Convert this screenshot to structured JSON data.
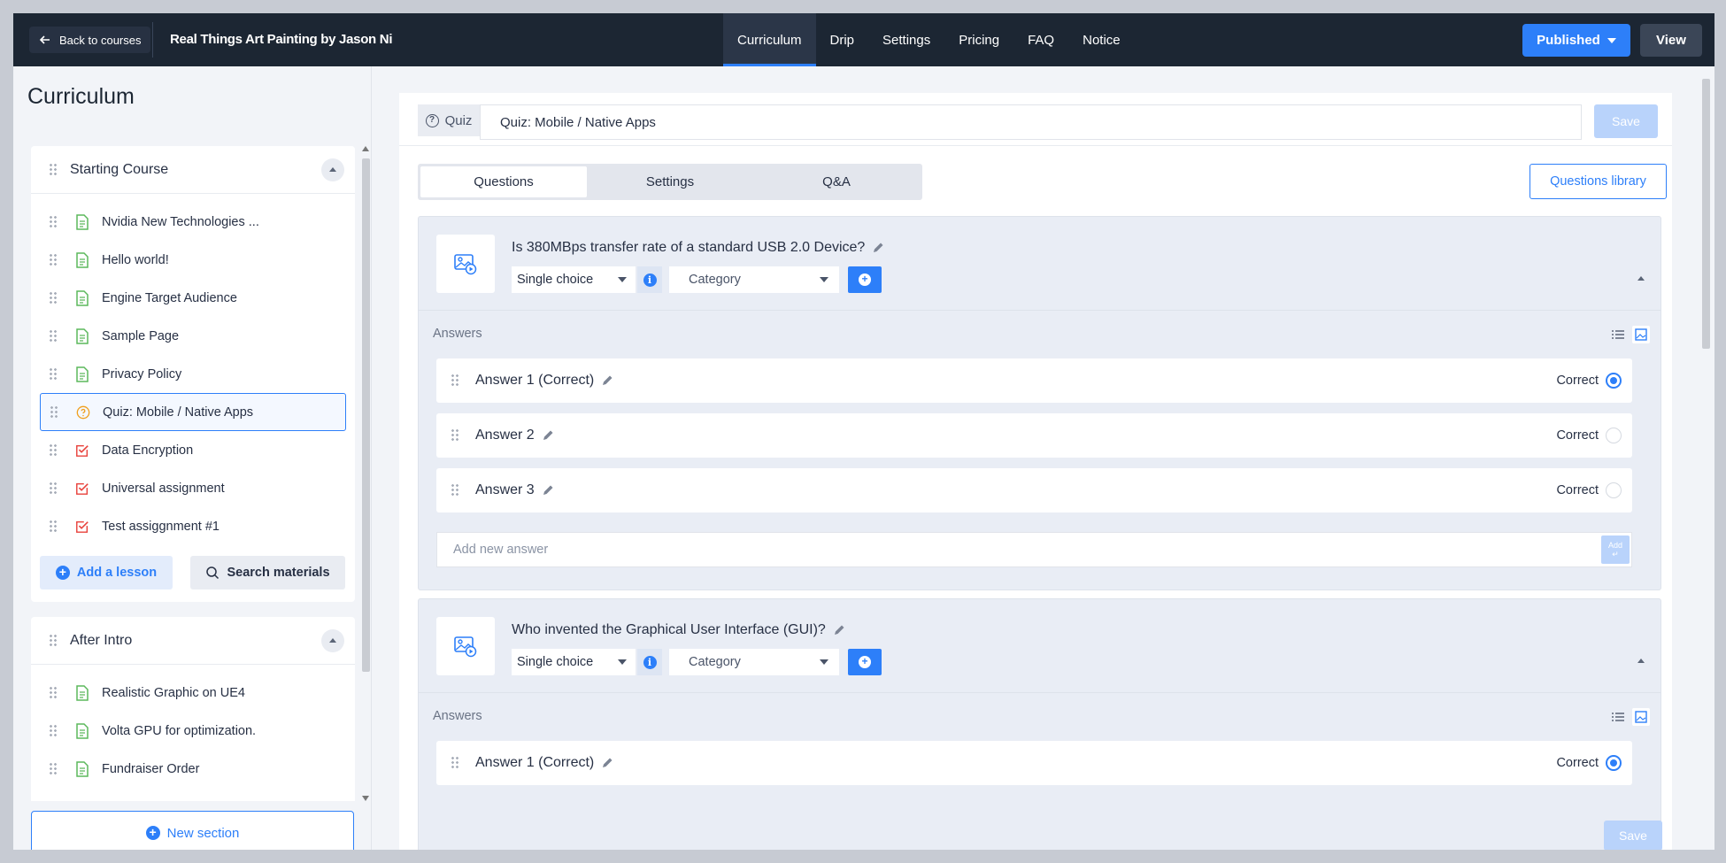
{
  "topbar": {
    "back_label": "Back to courses",
    "course_title": "Real Things Art Painting by Jason Ni",
    "tabs": [
      "Curriculum",
      "Drip",
      "Settings",
      "Pricing",
      "FAQ",
      "Notice"
    ],
    "active_tab": "Curriculum",
    "published_label": "Published",
    "view_label": "View"
  },
  "sidebar": {
    "title": "Curriculum",
    "sections": [
      {
        "name": "Starting Course",
        "lessons": [
          {
            "label": "Nvidia New Technologies ...",
            "type": "text"
          },
          {
            "label": "Hello world!",
            "type": "text"
          },
          {
            "label": "Engine Target Audience",
            "type": "text"
          },
          {
            "label": "Sample Page",
            "type": "text"
          },
          {
            "label": "Privacy Policy",
            "type": "text"
          },
          {
            "label": "Quiz: Mobile / Native Apps",
            "type": "quiz"
          },
          {
            "label": "Data Encryption",
            "type": "assignment"
          },
          {
            "label": "Universal assignment",
            "type": "assignment"
          },
          {
            "label": "Test assiggnment #1",
            "type": "assignment"
          }
        ],
        "add_lesson_label": "Add a lesson",
        "search_materials_label": "Search materials"
      },
      {
        "name": "After Intro",
        "lessons": [
          {
            "label": "Realistic Graphic on UE4",
            "type": "text"
          },
          {
            "label": "Volta GPU for optimization.",
            "type": "text"
          },
          {
            "label": "Fundraiser Order",
            "type": "text"
          }
        ]
      }
    ],
    "new_section_label": "New section"
  },
  "quiz": {
    "badge_label": "Quiz",
    "title_value": "Quiz: Mobile / Native Apps",
    "save_label": "Save",
    "tabs": [
      "Questions",
      "Settings",
      "Q&A"
    ],
    "active_tab": "Questions",
    "questions_library_label": "Questions library",
    "questions": [
      {
        "title": "Is 380MBps transfer rate of a standard USB 2.0 Device?",
        "type": "Single choice",
        "category": "Category",
        "answers_label": "Answers",
        "answers": [
          {
            "text": "Answer 1 (Correct)",
            "correct_label": "Correct",
            "checked": true
          },
          {
            "text": "Answer 2",
            "correct_label": "Correct",
            "checked": false
          },
          {
            "text": "Answer 3",
            "correct_label": "Correct",
            "checked": false
          }
        ],
        "add_answer_placeholder": "Add new answer",
        "add_button_label": "Add"
      },
      {
        "title": "Who invented the Graphical User Interface (GUI)?",
        "type": "Single choice",
        "category": "Category",
        "answers_label": "Answers",
        "answers": [
          {
            "text": "Answer 1 (Correct)",
            "correct_label": "Correct",
            "checked": true
          }
        ]
      }
    ],
    "bottom_save_label": "Save"
  },
  "colors": {
    "topbar_bg": "#1c2633",
    "accent": "#2d7ff9",
    "text_lesson_icon": "#5cb85c",
    "quiz_icon": "#f0a020",
    "assignment_icon": "#e8413b"
  }
}
